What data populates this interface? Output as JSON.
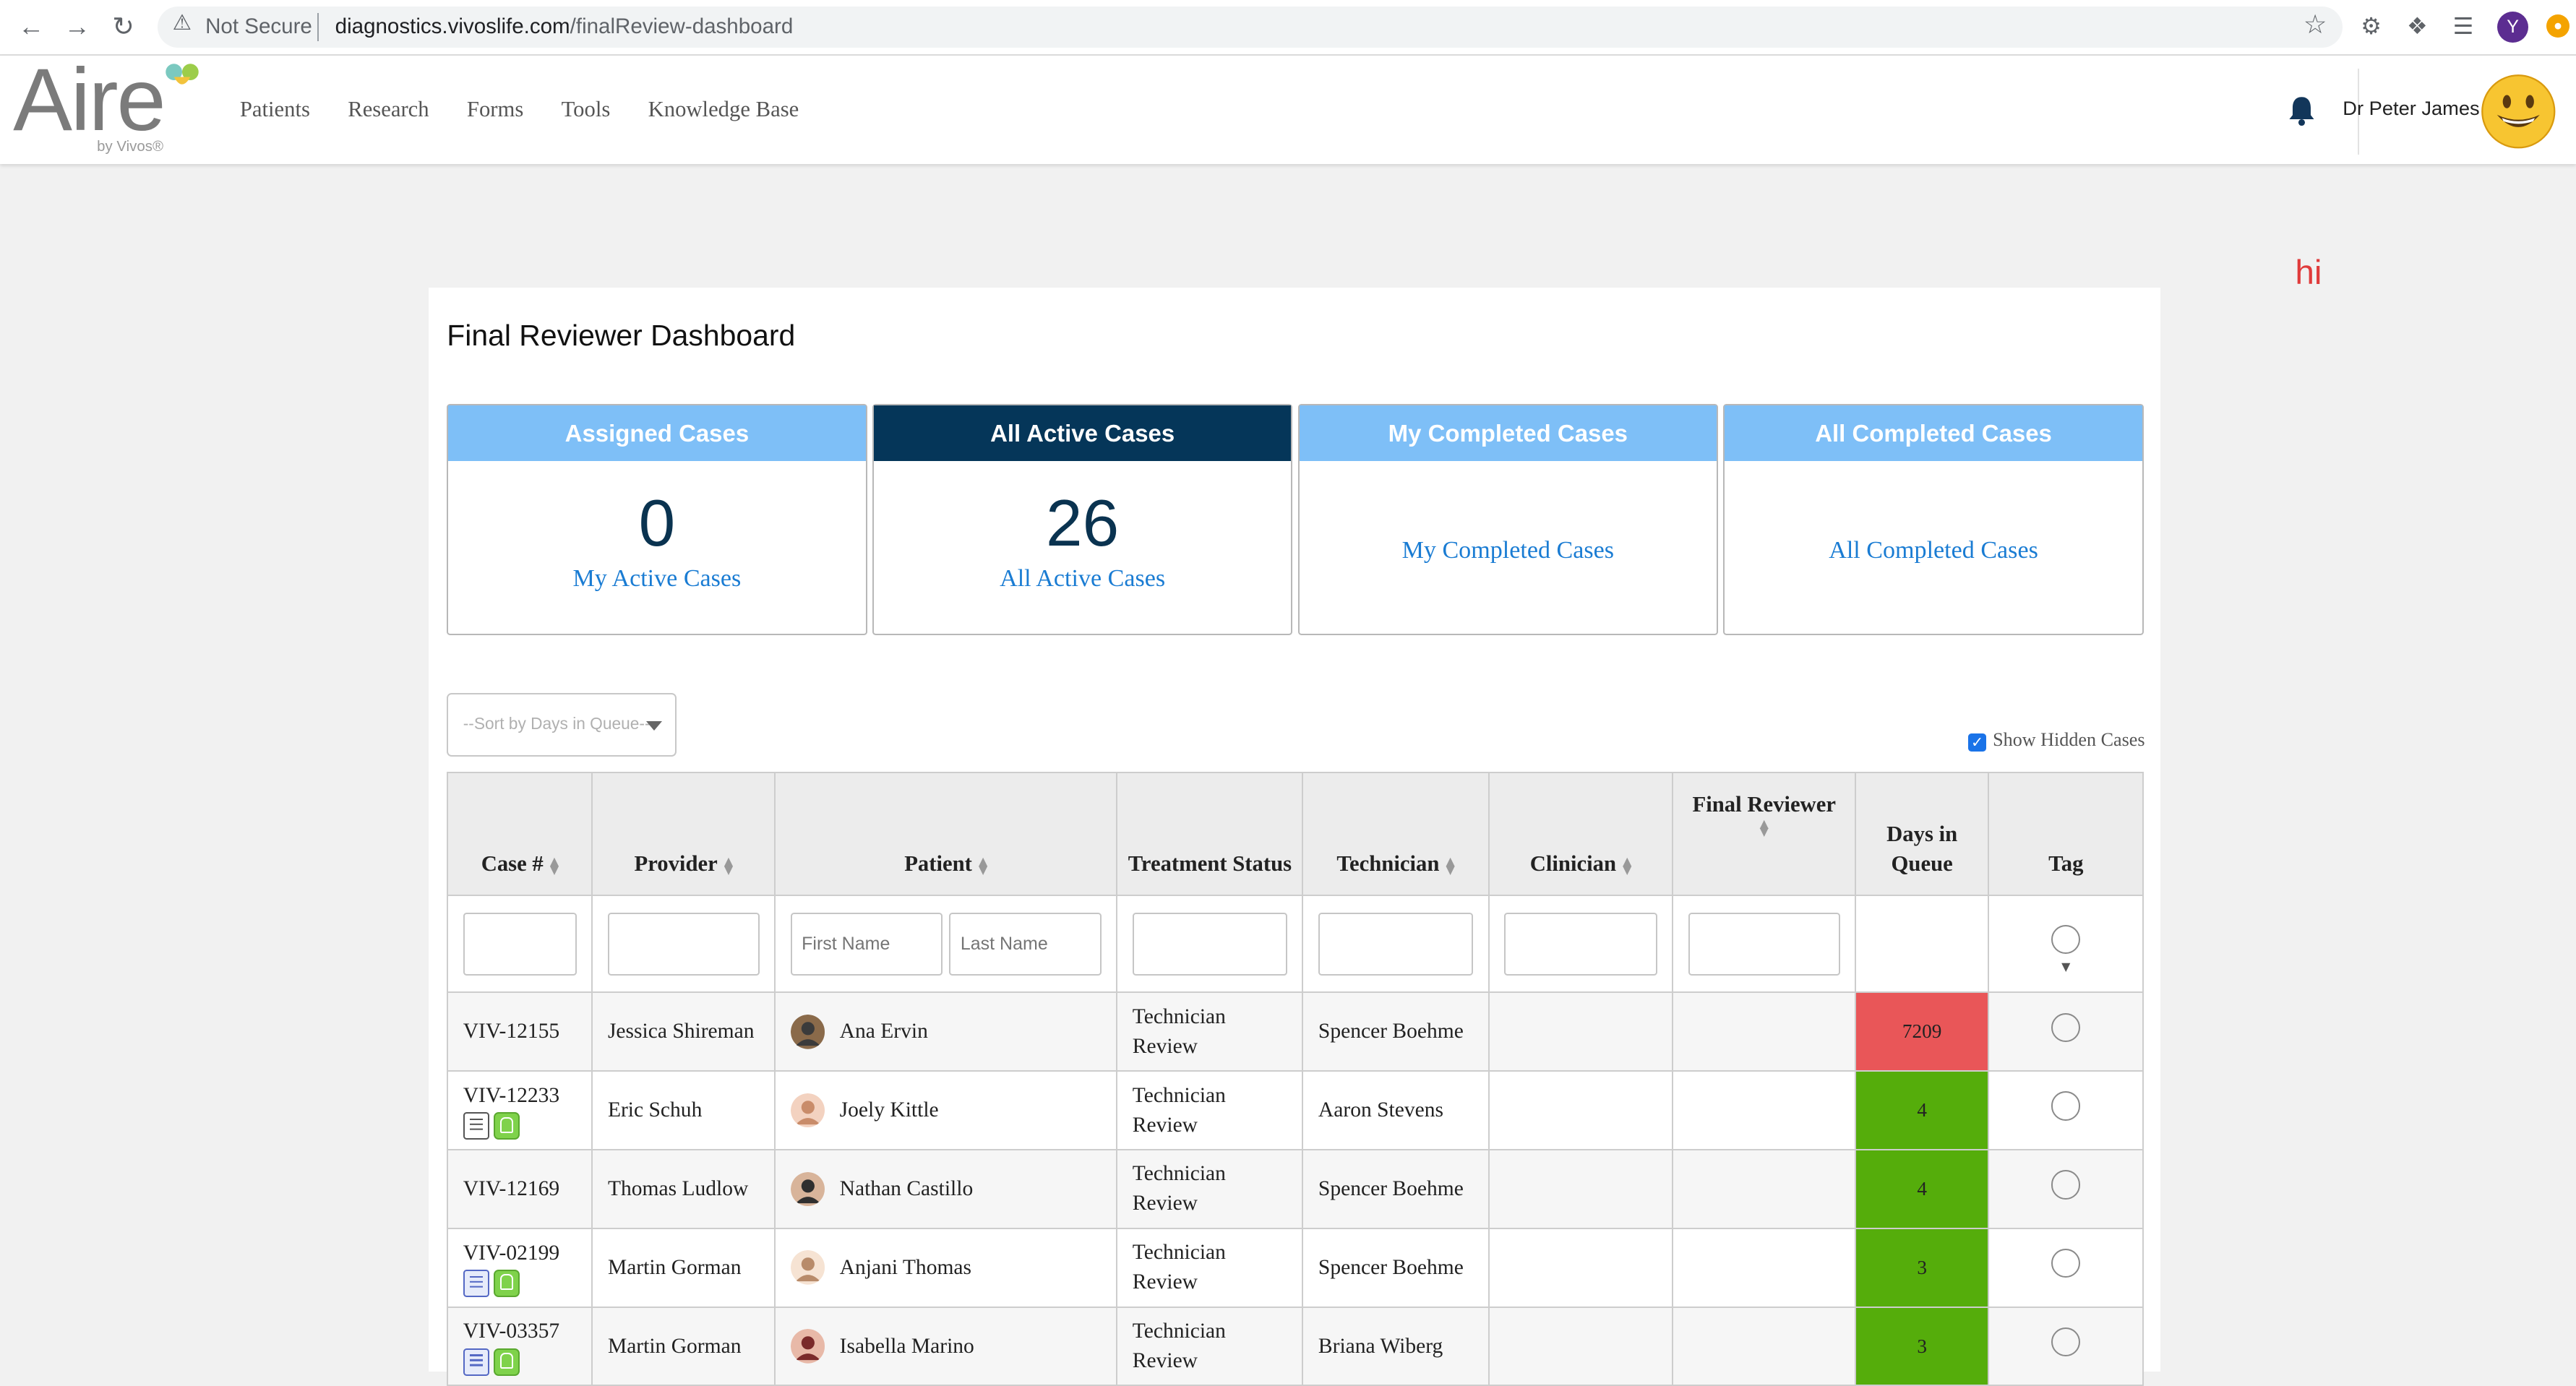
{
  "browser": {
    "security_label": "Not Secure",
    "url_host": "diagnostics.vivoslife.com",
    "url_path": "/finalReview-dashboard",
    "profile_initial": "Y"
  },
  "app": {
    "logo_text": "Aire",
    "logo_sub": "by Vivos®",
    "nav": [
      "Patients",
      "Research",
      "Forms",
      "Tools",
      "Knowledge Base"
    ],
    "user_name": "Dr Peter James",
    "debug_text": "hi"
  },
  "dashboard": {
    "title": "Final Reviewer Dashboard",
    "stats": [
      {
        "header": "Assigned Cases",
        "count": "0",
        "link": "My Active Cases",
        "active": false
      },
      {
        "header": "All Active Cases",
        "count": "26",
        "link": "All Active Cases",
        "active": true
      },
      {
        "header": "My Completed Cases",
        "count": "",
        "link": "My Completed Cases",
        "active": false
      },
      {
        "header": "All Completed Cases",
        "count": "",
        "link": "All Completed Cases",
        "active": false
      }
    ],
    "sort_placeholder": "--Sort by Days in Queue--",
    "show_hidden_label": "Show Hidden Cases",
    "show_hidden_checked": true
  },
  "table": {
    "columns": {
      "case": "Case #",
      "provider": "Provider",
      "patient": "Patient",
      "treatment": "Treatment Status",
      "technician": "Technician",
      "clinician": "Clinician",
      "final_reviewer": "Final Reviewer",
      "days": "Days in Queue",
      "tag": "Tag"
    },
    "filters": {
      "first_name_placeholder": "First Name",
      "last_name_placeholder": "Last Name"
    },
    "rows": [
      {
        "case": "VIV-12155",
        "provider": "Jessica Shireman",
        "patient": "Ana Ervin",
        "treatment": "Technician Review",
        "technician": "Spencer Boehme",
        "clinician": "",
        "final_reviewer": "",
        "days": "7209",
        "days_status": "red",
        "icons": []
      },
      {
        "case": "VIV-12233",
        "provider": "Eric Schuh",
        "patient": "Joely Kittle",
        "treatment": "Technician Review",
        "technician": "Aaron Stevens",
        "clinician": "",
        "final_reviewer": "",
        "days": "4",
        "days_status": "green",
        "icons": [
          "document-icon",
          "tooth-icon"
        ]
      },
      {
        "case": "VIV-12169",
        "provider": "Thomas Ludlow",
        "patient": "Nathan Castillo",
        "treatment": "Technician Review",
        "technician": "Spencer Boehme",
        "clinician": "",
        "final_reviewer": "",
        "days": "4",
        "days_status": "green",
        "icons": []
      },
      {
        "case": "VIV-02199",
        "provider": "Martin Gorman",
        "patient": "Anjani Thomas",
        "treatment": "Technician Review",
        "technician": "Spencer Boehme",
        "clinician": "",
        "final_reviewer": "",
        "days": "3",
        "days_status": "green",
        "icons": [
          "document-icon",
          "tooth-icon"
        ]
      },
      {
        "case": "VIV-03357",
        "provider": "Martin Gorman",
        "patient": "Isabella Marino",
        "treatment": "Technician Review",
        "technician": "Briana Wiberg",
        "clinician": "",
        "final_reviewer": "",
        "days": "3",
        "days_status": "green",
        "icons": [
          "document-icon",
          "tooth-icon"
        ]
      }
    ]
  },
  "colors": {
    "stat_header": "#7ebff7",
    "stat_header_active": "#053659",
    "link": "#1a7cd3",
    "days_red": "#e95658",
    "days_green": "#55ad0b"
  }
}
